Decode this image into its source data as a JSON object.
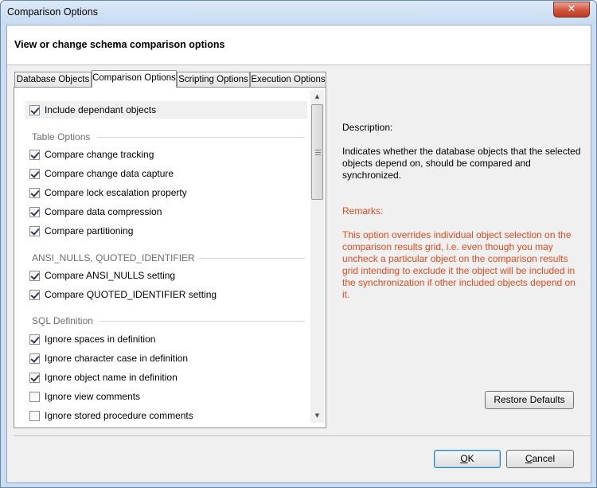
{
  "window": {
    "title": "Comparison Options",
    "close_symbol": "✕"
  },
  "header": {
    "title": "View or change schema comparison options"
  },
  "tabs": [
    {
      "label": "Database Objects",
      "active": false
    },
    {
      "label": "Comparison Options",
      "active": true
    },
    {
      "label": "Scripting Options",
      "active": false
    },
    {
      "label": "Execution Options",
      "active": false
    }
  ],
  "options": {
    "include_dependant": {
      "label": "Include dependant objects",
      "checked": true
    },
    "groups": {
      "table": {
        "label": "Table Options",
        "items": [
          {
            "label": "Compare change tracking",
            "checked": true
          },
          {
            "label": "Compare change data capture",
            "checked": true
          },
          {
            "label": "Compare lock escalation property",
            "checked": true
          },
          {
            "label": "Compare data compression",
            "checked": true
          },
          {
            "label": "Compare partitioning",
            "checked": true
          }
        ]
      },
      "ansi": {
        "label": "ANSI_NULLS, QUOTED_IDENTIFIER",
        "items": [
          {
            "label": "Compare ANSI_NULLS setting",
            "checked": true
          },
          {
            "label": "Compare QUOTED_IDENTIFIER setting",
            "checked": true
          }
        ]
      },
      "sql": {
        "label": "SQL Definition",
        "items": [
          {
            "label": "Ignore spaces in definition",
            "checked": true
          },
          {
            "label": "Ignore character case in definition",
            "checked": true
          },
          {
            "label": "Ignore object name in definition",
            "checked": true
          },
          {
            "label": "Ignore view comments",
            "checked": false
          },
          {
            "label": "Ignore stored procedure comments",
            "checked": false
          }
        ]
      }
    }
  },
  "description": {
    "title": "Description:",
    "text": "Indicates whether the database objects that the selected objects depend on, should be compared and synchronized."
  },
  "remarks": {
    "title": "Remarks:",
    "text": "This option overrides individual object selection on the comparison results grid, i.e. even though you may uncheck a particular object on the comparison results grid intending to exclude it the object will be included in the synchronization if other included objects depend on it."
  },
  "buttons": {
    "restore_defaults": "Restore Defaults",
    "ok": "OK",
    "cancel": "Cancel"
  },
  "scrollbar": {
    "up_arrow": "▲",
    "down_arrow": "▼"
  },
  "colors": {
    "remarks": "#e24b1f",
    "group_label": "#6d6d6d"
  }
}
